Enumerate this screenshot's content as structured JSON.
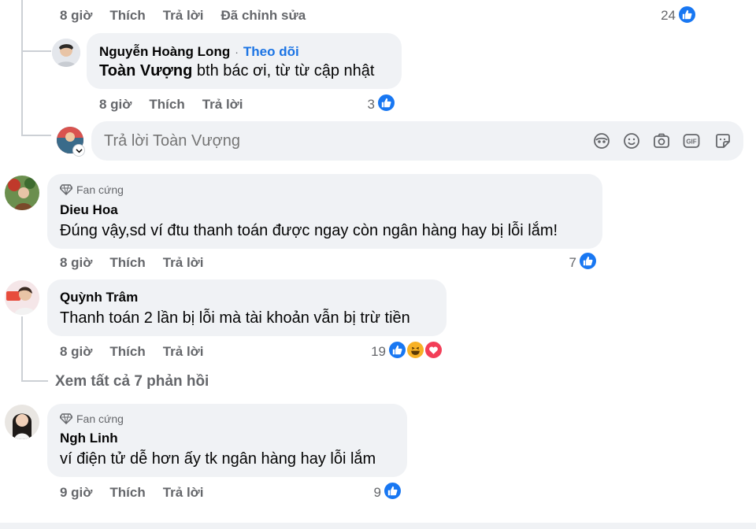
{
  "top": {
    "time": "8 giờ",
    "like": "Thích",
    "reply": "Trả lời",
    "edited": "Đã chỉnh sửa",
    "count": "24"
  },
  "reply1": {
    "author": "Nguyễn Hoàng Long",
    "sep": "·",
    "follow": "Theo dõi",
    "mention": "Toàn Vượng",
    "text": " bth bác ơi, từ từ cập nhật",
    "time": "8 giờ",
    "like": "Thích",
    "reply": "Trả lời",
    "count": "3"
  },
  "reply_input": {
    "placeholder": "Trả lời Toàn Vượng"
  },
  "comment1": {
    "badge": "Fan cứng",
    "author": "Dieu Hoa",
    "text": "Đúng vậy,sd ví đtu thanh toán được ngay còn ngân hàng hay bị lỗi lắm!",
    "time": "8 giờ",
    "like": "Thích",
    "reply": "Trả lời",
    "count": "7"
  },
  "comment2": {
    "author": "Quỳnh Trâm",
    "text": "Thanh toán 2 lần bị lỗi mà tài khoản vẫn bị trừ tiền",
    "time": "8 giờ",
    "like": "Thích",
    "reply": "Trả lời",
    "count": "19",
    "view_replies": "Xem tất cả 7 phản hồi"
  },
  "comment3": {
    "badge": "Fan cứng",
    "author": "Ngh Linh",
    "text": "ví điện tử dễ hơn ấy tk ngân hàng hay lỗi lắm",
    "time": "9 giờ",
    "like": "Thích",
    "reply": "Trả lời",
    "count": "9"
  },
  "colors": {
    "like_blue": "#1877f2",
    "link_blue": "#1b74e4",
    "bubble": "#f0f2f5",
    "meta": "#65676b"
  }
}
